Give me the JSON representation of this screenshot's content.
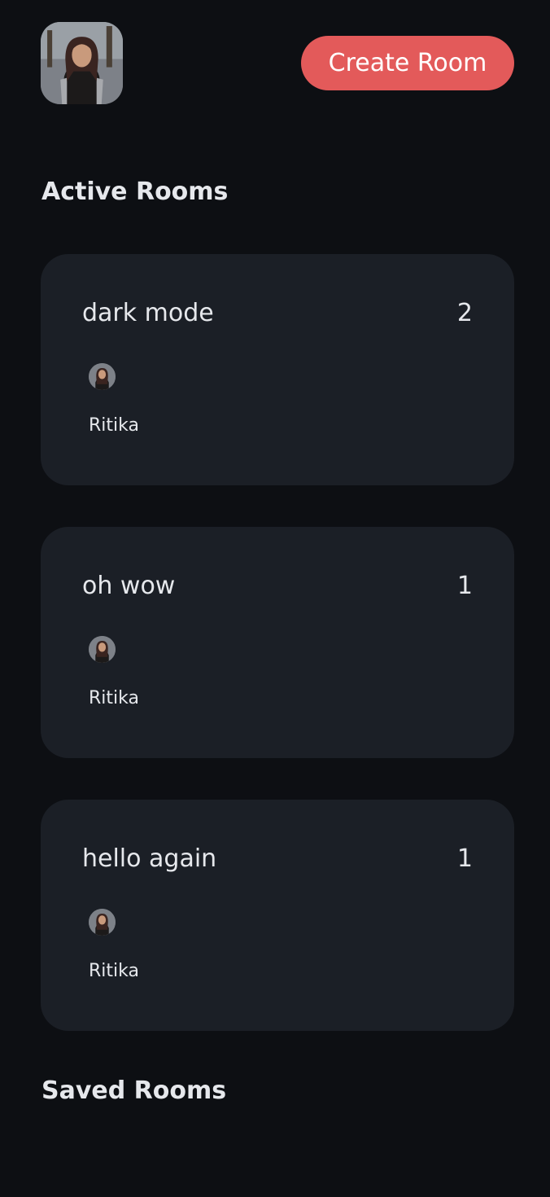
{
  "header": {
    "avatar": "user-avatar",
    "create_room_label": "Create Room"
  },
  "sections": {
    "active_title": "Active Rooms",
    "saved_title": "Saved Rooms"
  },
  "active_rooms": [
    {
      "title": "dark mode",
      "count": "2",
      "members": [
        "Ritika"
      ]
    },
    {
      "title": "oh wow",
      "count": "1",
      "members": [
        "Ritika"
      ]
    },
    {
      "title": "hello again",
      "count": "1",
      "members": [
        "Ritika"
      ]
    }
  ],
  "colors": {
    "background": "#0d0f13",
    "card": "#1b1f26",
    "accent": "#e35a5a",
    "text": "#e6e8ec"
  }
}
